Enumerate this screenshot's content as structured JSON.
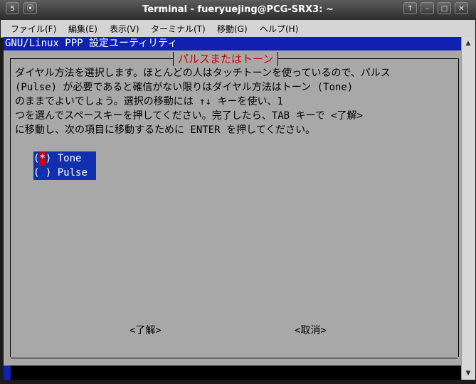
{
  "window": {
    "title": "Terminal - fueryuejing@PCG-SRX3: ~",
    "icon": "terminal-icon",
    "controls": [
      "arrow-up-icon",
      "minimize-icon",
      "maximize-icon",
      "close-icon"
    ]
  },
  "menubar": {
    "items": [
      "ファイル(F)",
      "編集(E)",
      "表示(V)",
      "ターミナル(T)",
      "移動(G)",
      "ヘルプ(H)"
    ]
  },
  "terminal": {
    "header": "GNU/Linux PPP 設定ユーティリティ",
    "dialog": {
      "title": "パルスまたはトーン",
      "description": [
        "ダイヤル方法を選択します。ほとんどの人はタッチトーンを使っているので、パルス",
        "(Pulse) が必要であると確信がない限りはダイヤル方法はトーン (Tone)",
        "のままでよいでしょう。選択の移動には ↑↓ キーを使い、1",
        "つを選んでスペースキーを押してください。完了したら、TAB キーで <了解>",
        "に移動し、次の項目に移動するために ENTER を押してください。"
      ],
      "options": [
        {
          "mark": "*",
          "label": "Tone",
          "selected": true
        },
        {
          "mark": " ",
          "label": "Pulse",
          "selected": false
        }
      ],
      "ok_button": "<了解>",
      "cancel_button": "<取消>"
    }
  },
  "colors": {
    "terminal_bg": "#a8a8a8",
    "header_bg": "#1020b0",
    "dialog_title": "#d00000",
    "option_bg": "#1030b0"
  }
}
